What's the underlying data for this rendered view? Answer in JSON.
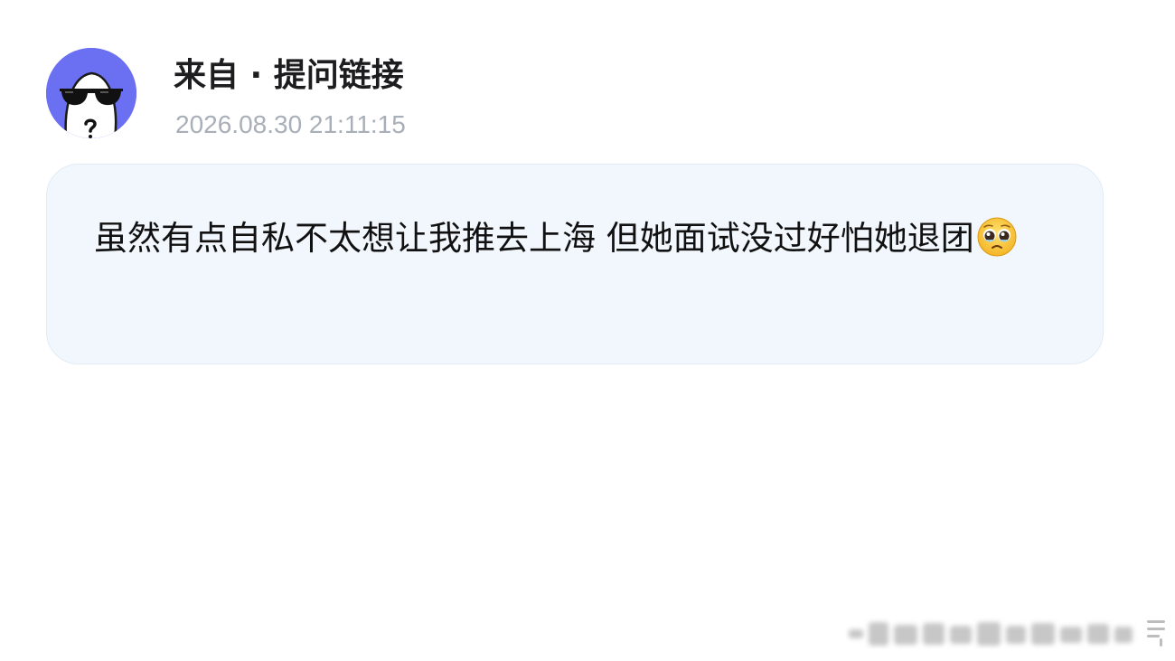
{
  "post": {
    "sender": "来自 · 提问链接",
    "timestamp": "2026.08.30 21:11:15",
    "message": "虽然有点自私不太想让我推去上海 但她面试没过好怕她退团",
    "emoji": "pleading-face-emoji"
  },
  "icons": {
    "avatar": "sunglasses-face-avatar",
    "watermark": "blurred-watermark"
  },
  "colors": {
    "avatar_bg": "#6b6ff2",
    "bubble_bg": "#f2f7fd",
    "timestamp": "#a9afb8",
    "text": "#111111"
  }
}
